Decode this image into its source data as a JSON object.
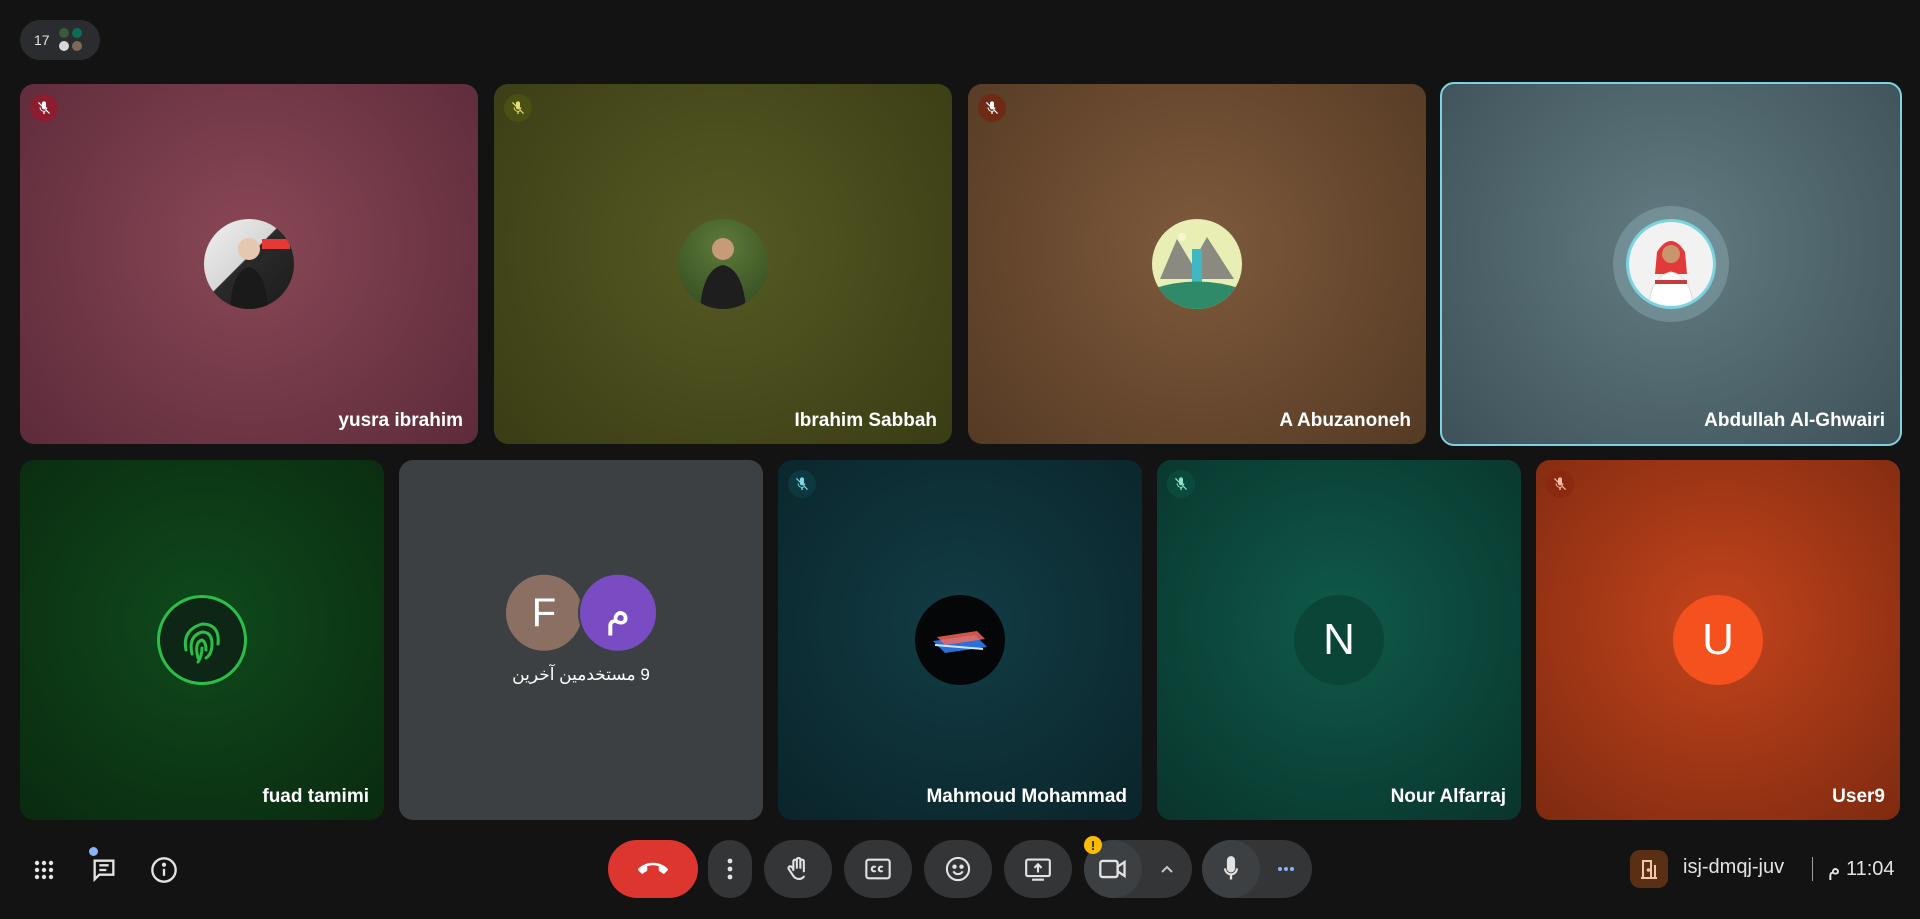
{
  "header": {
    "participant_count": "17"
  },
  "tiles": [
    {
      "name": "yusra ibrahim",
      "mic_muted": true,
      "mic_color": "#8c1d2e",
      "avatar": "photo"
    },
    {
      "name": "Ibrahim Sabbah",
      "mic_muted": true,
      "mic_color": "#4a5014",
      "avatar": "photo"
    },
    {
      "name": "A Abuzanoneh",
      "mic_muted": true,
      "mic_color": "#6e2a14",
      "avatar": "illustration"
    },
    {
      "name": "Abdullah Al-Ghwairi",
      "mic_muted": false,
      "active_speaker": true,
      "avatar": "photo"
    },
    {
      "name": "fuad tamimi",
      "mic_muted": false,
      "avatar": "fingerprint-logo"
    },
    {
      "others_label": "9 مستخدمين آخرين",
      "others_avatars": [
        {
          "letter": "F",
          "color": "#8b6f63"
        },
        {
          "letter": "م",
          "color": "#7a4cc4"
        }
      ]
    },
    {
      "name": "Mahmoud Mohammad",
      "mic_muted": true,
      "mic_color": "#0c3840",
      "avatar": "image"
    },
    {
      "name": "Nour Alfarraj",
      "mic_muted": true,
      "mic_color": "#0a4a3c",
      "letter": "N",
      "letter_bg": "#0c4a3c"
    },
    {
      "name": "User9",
      "mic_muted": true,
      "mic_color": "#8a2810",
      "letter": "U",
      "letter_bg": "#f4511e"
    }
  ],
  "toolbar": {
    "meeting_code": "isj-dmqj-juv",
    "time": "11:04 م"
  },
  "colors": {
    "end_call": "#dc362e",
    "active_border": "#7bd3e0",
    "accent": "#8ab4f8"
  }
}
